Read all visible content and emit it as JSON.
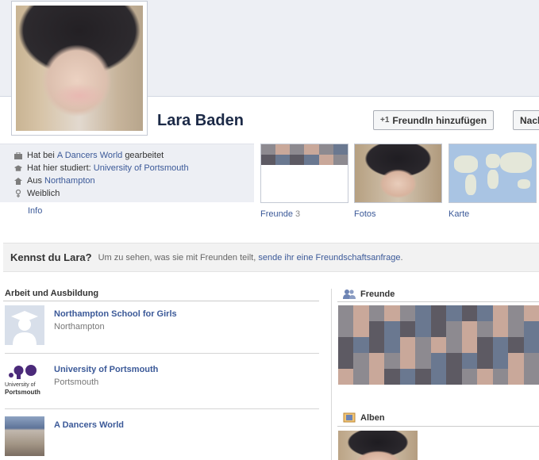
{
  "profile": {
    "name": "Lara Baden",
    "add_friend_label": "FreundIn hinzufügen",
    "message_label": "Nachricht senden"
  },
  "info": {
    "work_prefix": "Hat bei",
    "work_place": "A Dancers World",
    "work_suffix": "gearbeitet",
    "study_prefix": "Hat hier studiert:",
    "study_place": "University of Portsmouth",
    "from_prefix": "Aus",
    "from_place": "Northampton",
    "gender": "Weiblich",
    "info_link": "Info"
  },
  "thumbnails": {
    "friends_label": "Freunde",
    "friends_count": "3",
    "photos_label": "Fotos",
    "map_label": "Karte"
  },
  "ask": {
    "question": "Kennst du Lara?",
    "text": "Um zu sehen, was sie mit Freunden teilt,",
    "link": "sende ihr eine Freundschaftsanfrage",
    "end": "."
  },
  "work_education": {
    "title": "Arbeit und Ausbildung",
    "items": [
      {
        "name": "Northampton School for Girls",
        "place": "Northampton"
      },
      {
        "name": "University of Portsmouth",
        "place": "Portsmouth",
        "logo_text_1": "University of",
        "logo_text_2": "Portsmouth"
      },
      {
        "name": "A Dancers World",
        "place": ""
      }
    ]
  },
  "sidebar": {
    "friends_title": "Freunde",
    "albums_title": "Alben"
  },
  "colors": {
    "link": "#3b5998",
    "header_bg": "#edeff4"
  }
}
